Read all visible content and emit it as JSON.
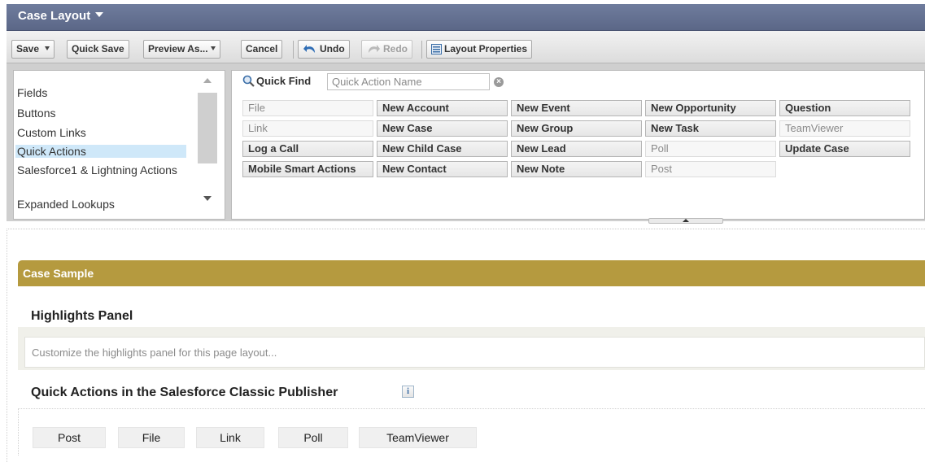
{
  "header": {
    "title": "Case Layout"
  },
  "toolbar": {
    "save": "Save",
    "quick_save": "Quick Save",
    "preview_as": "Preview As...",
    "cancel": "Cancel",
    "undo": "Undo",
    "redo": "Redo",
    "layout_properties": "Layout Properties"
  },
  "palette": {
    "categories": [
      {
        "label": "Fields",
        "selected": false
      },
      {
        "label": "Buttons",
        "selected": false
      },
      {
        "label": "Custom Links",
        "selected": false
      },
      {
        "label": "Quick Actions",
        "selected": true
      },
      {
        "label": "Salesforce1 & Lightning Actions",
        "selected": false
      },
      {
        "label": "Expanded Lookups",
        "selected": false
      }
    ],
    "quick_find": {
      "label": "Quick Find",
      "placeholder": "Quick Action Name",
      "value": ""
    },
    "actions": [
      [
        {
          "label": "File",
          "used": true
        },
        {
          "label": "New Account",
          "used": false
        },
        {
          "label": "New Event",
          "used": false
        },
        {
          "label": "New Opportunity",
          "used": false
        },
        {
          "label": "Question",
          "used": false
        }
      ],
      [
        {
          "label": "Link",
          "used": true
        },
        {
          "label": "New Case",
          "used": false
        },
        {
          "label": "New Group",
          "used": false
        },
        {
          "label": "New Task",
          "used": false
        },
        {
          "label": "TeamViewer",
          "used": true
        }
      ],
      [
        {
          "label": "Log a Call",
          "used": false
        },
        {
          "label": "New Child Case",
          "used": false
        },
        {
          "label": "New Lead",
          "used": false
        },
        {
          "label": "Poll",
          "used": true
        },
        {
          "label": "Update Case",
          "used": false
        }
      ],
      [
        {
          "label": "Mobile Smart Actions",
          "used": false
        },
        {
          "label": "New Contact",
          "used": false
        },
        {
          "label": "New Note",
          "used": false
        },
        {
          "label": "Post",
          "used": true
        }
      ]
    ]
  },
  "layout": {
    "sample_header": "Case Sample",
    "highlights_title": "Highlights Panel",
    "highlights_hint": "Customize the highlights panel for this page layout...",
    "publisher_title": "Quick Actions in the Salesforce Classic Publisher",
    "info_glyph": "i",
    "publisher_actions": [
      "Post",
      "File",
      "Link",
      "Poll",
      "TeamViewer"
    ]
  },
  "colors": {
    "title_bar": "#5b6787",
    "section_header": "#b59a3f",
    "selected_item": "#cfe8f9"
  }
}
